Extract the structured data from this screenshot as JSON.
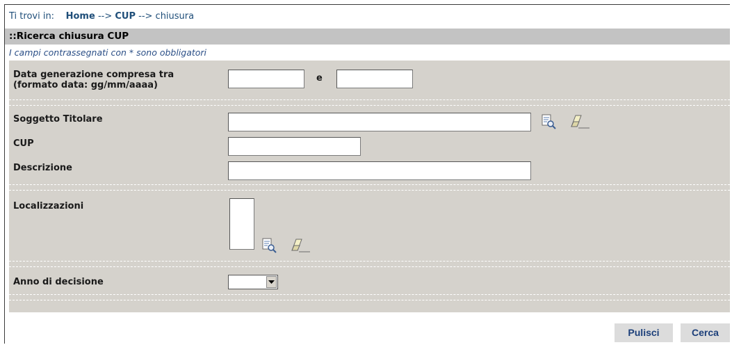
{
  "breadcrumb": {
    "prefix": "Ti trovi in:",
    "home": "Home",
    "sep1": "-->",
    "cup": "CUP",
    "sep2": "-->",
    "current": "chiusura"
  },
  "section": {
    "title": "::Ricerca chiusura CUP",
    "required_note": "I campi contrassegnati con * sono obbligatori"
  },
  "form": {
    "date_label_line1": "Data generazione compresa tra",
    "date_label_line2": "(formato data: gg/mm/aaaa)",
    "date_between": "e",
    "date_from": "",
    "date_to": "",
    "soggetto_label": "Soggetto Titolare",
    "soggetto_value": "",
    "cup_label": "CUP",
    "cup_value": "",
    "descrizione_label": "Descrizione",
    "descrizione_value": "",
    "localizzazioni_label": "Localizzazioni",
    "anno_label": "Anno di decisione",
    "anno_value": ""
  },
  "icons": {
    "search": "search-document-icon",
    "clear": "eraser-icon"
  },
  "buttons": {
    "clear": "Pulisci",
    "search": "Cerca"
  },
  "colors": {
    "panel": "#d5d2cc",
    "title_bar": "#c3c3c3",
    "link": "#1f4e79",
    "button_text": "#1c3f7a"
  }
}
